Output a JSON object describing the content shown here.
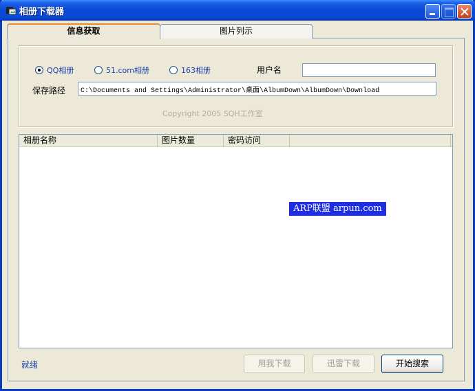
{
  "window": {
    "title": "相册下载器"
  },
  "tabs": [
    {
      "label": "信息获取",
      "active": true
    },
    {
      "label": "图片列示",
      "active": false
    }
  ],
  "source_options": [
    {
      "label": "QQ相册",
      "selected": true
    },
    {
      "label": "51.com相册",
      "selected": false
    },
    {
      "label": "163相册",
      "selected": false
    }
  ],
  "username": {
    "label": "用户名",
    "value": ""
  },
  "save_path": {
    "label": "保存路径",
    "value": "C:\\Documents and Settings\\Administrator\\桌面\\AlbumDown\\AlbumDown\\Download"
  },
  "copyright": "Copyright 2005   SQH工作室",
  "list": {
    "columns": [
      "相册名称",
      "图片数量",
      "密码访问",
      ""
    ],
    "rows": []
  },
  "watermark": "ARP联盟 arpun.com",
  "status": "就绪",
  "buttons": {
    "download_self": "用我下载",
    "download_thunder": "迅雷下载",
    "start_search": "开始搜索"
  },
  "colors": {
    "title_bar": "#0a48d6",
    "accent_tab": "#e68b2c",
    "link_text": "#1a3fa8"
  }
}
